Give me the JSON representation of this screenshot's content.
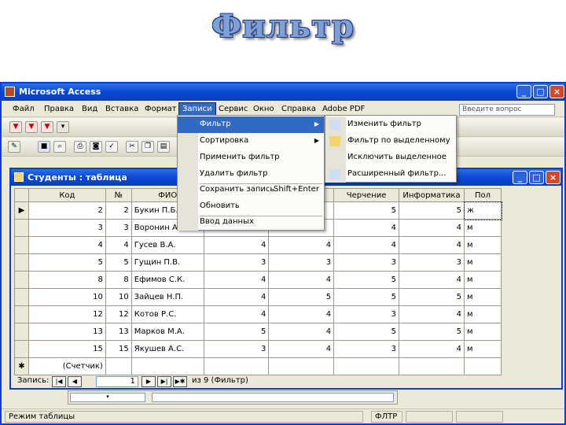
{
  "slide_title": "Фильтр",
  "app": {
    "title": "Microsoft Access",
    "menu": [
      "Файл",
      "Правка",
      "Вид",
      "Вставка",
      "Формат",
      "Записи",
      "Сервис",
      "Окно",
      "Справка",
      "Adobe PDF"
    ],
    "ask_placeholder": "Введите вопрос",
    "window_buttons": [
      "_",
      "□",
      "×"
    ]
  },
  "records_menu": {
    "items": [
      {
        "label": "Фильтр",
        "shortcut": "",
        "submenu": true
      },
      {
        "label": "Сортировка",
        "shortcut": "",
        "submenu": true
      },
      {
        "label": "Применить фильтр",
        "shortcut": ""
      },
      {
        "label": "Удалить фильтр",
        "shortcut": ""
      },
      {
        "label": "Сохранить запись",
        "shortcut": "Shift+Enter"
      },
      {
        "label": "Обновить",
        "shortcut": ""
      },
      {
        "label": "Ввод данных",
        "shortcut": ""
      }
    ]
  },
  "filter_submenu": {
    "items": [
      "Изменить фильтр",
      "Фильтр по выделенному",
      "Исключить выделенное",
      "Расширенный фильтр..."
    ]
  },
  "table_window": {
    "title": "Студенты : таблица",
    "columns": [
      "Код",
      "№",
      "ФИО",
      "",
      "",
      "Черчение",
      "Информатика",
      "Пол"
    ],
    "rows": [
      {
        "selector": "▶",
        "kod": "2",
        "num": "2",
        "fio": "Букин П.Б.",
        "c4": "",
        "c5": "",
        "cherch": "5",
        "inf": "5",
        "pol": "ж"
      },
      {
        "selector": "",
        "kod": "3",
        "num": "3",
        "fio": "Воронин А.А.",
        "c4": "",
        "c5": "",
        "cherch": "4",
        "inf": "4",
        "pol": "м"
      },
      {
        "selector": "",
        "kod": "4",
        "num": "4",
        "fio": "Гусев В.А.",
        "c4": "4",
        "c5": "4",
        "cherch": "4",
        "inf": "4",
        "pol": "м"
      },
      {
        "selector": "",
        "kod": "5",
        "num": "5",
        "fio": "Гущин П.В.",
        "c4": "3",
        "c5": "3",
        "cherch": "3",
        "inf": "3",
        "pol": "м"
      },
      {
        "selector": "",
        "kod": "8",
        "num": "8",
        "fio": "Ефимов С.К.",
        "c4": "4",
        "c5": "4",
        "cherch": "5",
        "inf": "4",
        "pol": "м"
      },
      {
        "selector": "",
        "kod": "10",
        "num": "10",
        "fio": "Зайцев Н.П.",
        "c4": "4",
        "c5": "5",
        "cherch": "5",
        "inf": "5",
        "pol": "м"
      },
      {
        "selector": "",
        "kod": "12",
        "num": "12",
        "fio": "Котов Р.С.",
        "c4": "4",
        "c5": "4",
        "cherch": "3",
        "inf": "4",
        "pol": "м"
      },
      {
        "selector": "",
        "kod": "13",
        "num": "13",
        "fio": "Марков М.А.",
        "c4": "5",
        "c5": "4",
        "cherch": "5",
        "inf": "5",
        "pol": "м"
      },
      {
        "selector": "",
        "kod": "15",
        "num": "15",
        "fio": "Якушев А.С.",
        "c4": "3",
        "c5": "4",
        "cherch": "3",
        "inf": "4",
        "pol": "м"
      }
    ],
    "new_row": {
      "selector": "✱",
      "kod": "(Счетчик)"
    }
  },
  "nav": {
    "label": "Запись:",
    "current": "1",
    "total_text": "из 9 (Фильтр)"
  },
  "status": {
    "mode": "Режим таблицы",
    "indicator": "ФЛТР"
  }
}
